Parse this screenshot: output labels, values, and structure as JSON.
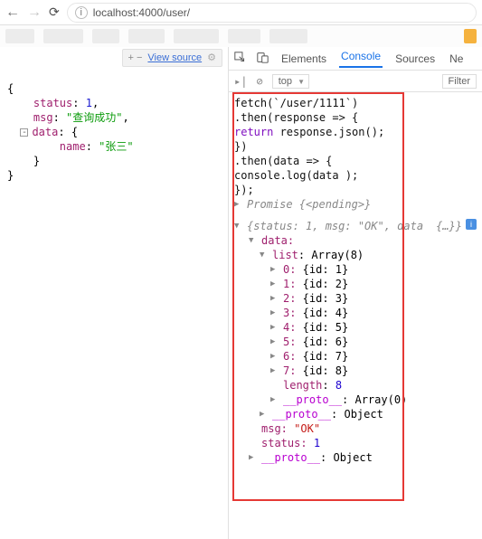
{
  "browser": {
    "url_label": "localhost:4000/user/",
    "view_source": "View source"
  },
  "json_left": {
    "status_key": "status",
    "status_val": "1",
    "msg_key": "msg",
    "msg_val": "\"查询成功\"",
    "data_key": "data",
    "name_key": "name",
    "name_val": "\"张三\""
  },
  "devtools": {
    "tabs": {
      "elements": "Elements",
      "console": "Console",
      "sources": "Sources",
      "ne": "Ne"
    },
    "filter_ctx": "top",
    "filter_ph": "Filter"
  },
  "console_code": {
    "l1": "fetch(`/user/1111`)",
    "l2": "  .then(response => {",
    "l3": "    return response.json();",
    "l4": "  })",
    "l5": "  .then(data => {",
    "l6": "    console.log(data );",
    "l7": "  });"
  },
  "promise_line": "Promise {<pending>}",
  "resp_top": {
    "preview_a": "{status: 1, msg: \"OK\", data",
    "preview_b": "{…}}",
    "data_key": "data:",
    "list_label": "list: Array(8)",
    "items": [
      {
        "idx": "0:",
        "body": "{id: 1}"
      },
      {
        "idx": "1:",
        "body": "{id: 2}"
      },
      {
        "idx": "2:",
        "body": "{id: 3}"
      },
      {
        "idx": "3:",
        "body": "{id: 4}"
      },
      {
        "idx": "4:",
        "body": "{id: 5}"
      },
      {
        "idx": "5:",
        "body": "{id: 6}"
      },
      {
        "idx": "6:",
        "body": "{id: 7}"
      },
      {
        "idx": "7:",
        "body": "{id: 8}"
      }
    ],
    "length_k": "length",
    "length_v": "8",
    "proto_arr": ": Array(0)",
    "proto_obj": ": Object",
    "msg_k": "msg:",
    "msg_v": "\"OK\"",
    "status_k": "status:",
    "status_v": "1",
    "proto_txt": "__proto__"
  }
}
